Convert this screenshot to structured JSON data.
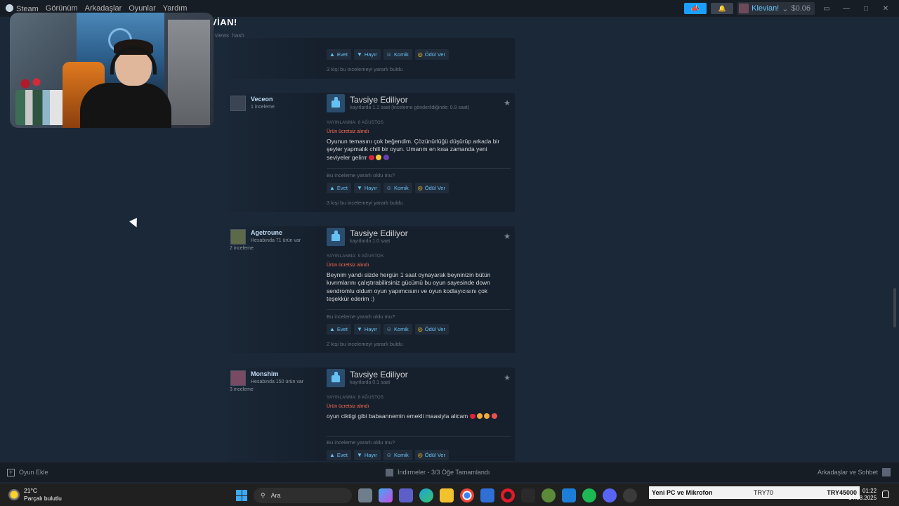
{
  "topbar": {
    "menu": [
      "Steam",
      "Görünüm",
      "Arkadaşlar",
      "Oyunlar",
      "Yardım"
    ],
    "user_name": "Klevian!",
    "balance": "$0.06"
  },
  "page": {
    "title_fragment": "VİAN!",
    "sub_fragment": "views_hash"
  },
  "common": {
    "recommended": "Tavsiye Ediliyor",
    "free_tag": "Ürün ücretsiz alındı",
    "helpful_question": "Bu inceleme yararlı oldu mu?",
    "vote_yes": "Evet",
    "vote_no": "Hayır",
    "vote_funny": "Komik",
    "vote_award": "Ödül Ver"
  },
  "top_partial": {
    "helpful_count": "3 kişi bu incelemeyi yararlı buldu"
  },
  "reviews": [
    {
      "author": "Veceon",
      "meta": "1 inceleme",
      "meta2": "",
      "hours": "kayıtlarda 1.1 saat (inceleme gönderildiğinde: 0.9 saat)",
      "posted": "YAYINLANMA: 8 AĞUSTOS",
      "text": "Oyunun temasını çok beğendim. Çözünürlüğü düşürüp arkada bir şeyler yapmalık chill bir oyun. Umarım en kısa zamanda yeni seviyeler gelirrr",
      "helpful_count": "3 kişi bu incelemeyi yararlı buldu"
    },
    {
      "author": "Agetroune",
      "meta": "Hesabında 71 ürün var",
      "meta2": "2 inceleme",
      "hours": "kayıtlarda 1.0 saat",
      "posted": "YAYINLANMA: 9 AĞUSTOS",
      "text": "Beynim yandı sizde hergün 1 saat oynayarak beyninizin bütün kıvrımlarını çalıştırabilirsiniz gücümü bu oyun sayesinde down sendromlu oldum oyun yapımcısını ve oyun kodlayıcısını çok teşekkür ederim :)",
      "helpful_count": "2 kişi bu incelemeyi yararlı buldu"
    },
    {
      "author": "Monshim",
      "meta": "Hesabında 150 ürün var",
      "meta2": "3 inceleme",
      "hours": "kayıtlarda 0.1 saat",
      "posted": "YAYINLANMA: 8 AĞUSTOS",
      "text": "oyun ciktigi gibi babaannemin emekli maasiyla alicam",
      "helpful_count": ""
    }
  ],
  "steam_bottom": {
    "add_game": "Oyun Ekle",
    "downloads": "İndirmeler - 3/3 Öğe Tamamlandı",
    "friends": "Arkadaşlar ve Sohbet"
  },
  "taskbar": {
    "temperature": "21°C",
    "weather": "Parçalı bulutlu",
    "search_placeholder": "Ara",
    "ticker_title": "Yeni PC ve Mikrofon",
    "ticker_mid": "TRY70",
    "ticker_goal": "TRY45000",
    "time": "01:22",
    "date": "14.08.2025"
  },
  "colors": {
    "background": "#1b2838",
    "accent": "#66c0f4",
    "free_tag": "#ff6b50",
    "award": "#ffc82c"
  }
}
